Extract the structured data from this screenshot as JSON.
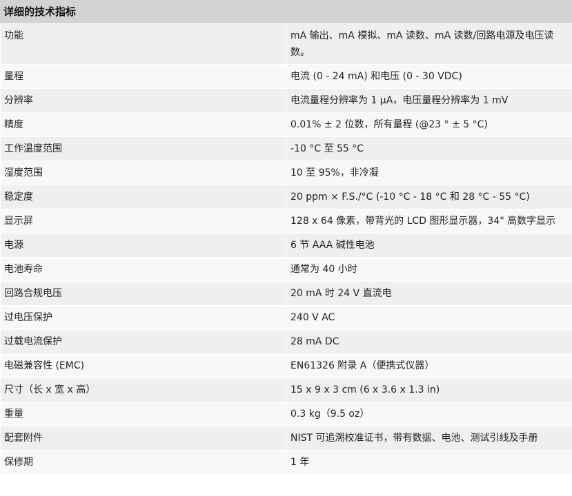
{
  "header": {
    "title": "详细的技术指标"
  },
  "rows": [
    {
      "label": "功能",
      "value": "mA 输出、mA 模拟、mA 读数、mA 读数/回路电源及电压读数。"
    },
    {
      "label": "量程",
      "value": "电流 (0 - 24 mA) 和电压 (0 - 30 VDC)"
    },
    {
      "label": "分辨率",
      "value": "电流量程分辨率为 1 µA，电压量程分辨率为 1 mV"
    },
    {
      "label": "精度",
      "value": "0.01% ± 2 位数，所有量程 (@23 ° ± 5 °C)"
    },
    {
      "label": "工作温度范围",
      "value": "-10 °C 至 55 °C"
    },
    {
      "label": "湿度范围",
      "value": "10 至 95%，非冷凝"
    },
    {
      "label": "稳定度",
      "value": "20 ppm × F.S./°C (-10 °C - 18 °C 和 28 °C - 55 °C)"
    },
    {
      "label": "显示屏",
      "value": "128 x 64 像素，带背光的 LCD 图形显示器，34\" 高数字显示"
    },
    {
      "label": "电源",
      "value": "6 节 AAA 碱性电池"
    },
    {
      "label": "电池寿命",
      "value": "通常为 40 小时"
    },
    {
      "label": "回路合规电压",
      "value": "20 mA 时 24 V 直流电"
    },
    {
      "label": "过电压保护",
      "value": "240 V AC"
    },
    {
      "label": "过载电流保护",
      "value": "28 mA DC"
    },
    {
      "label": "电磁兼容性 (EMC)",
      "value": "EN61326 附录 A（便携式仪器）"
    },
    {
      "label": "尺寸（长 x 宽 x 高）",
      "value": "15 x 9 x 3 cm (6 x 3.6 x 1.3 in)"
    },
    {
      "label": "重量",
      "value": "0.3 kg（9.5 oz）"
    },
    {
      "label": "配套附件",
      "value": "NIST 可追溯校准证书，带有数据、电池、测试引线及手册"
    },
    {
      "label": "保修期",
      "value": "1 年"
    }
  ]
}
